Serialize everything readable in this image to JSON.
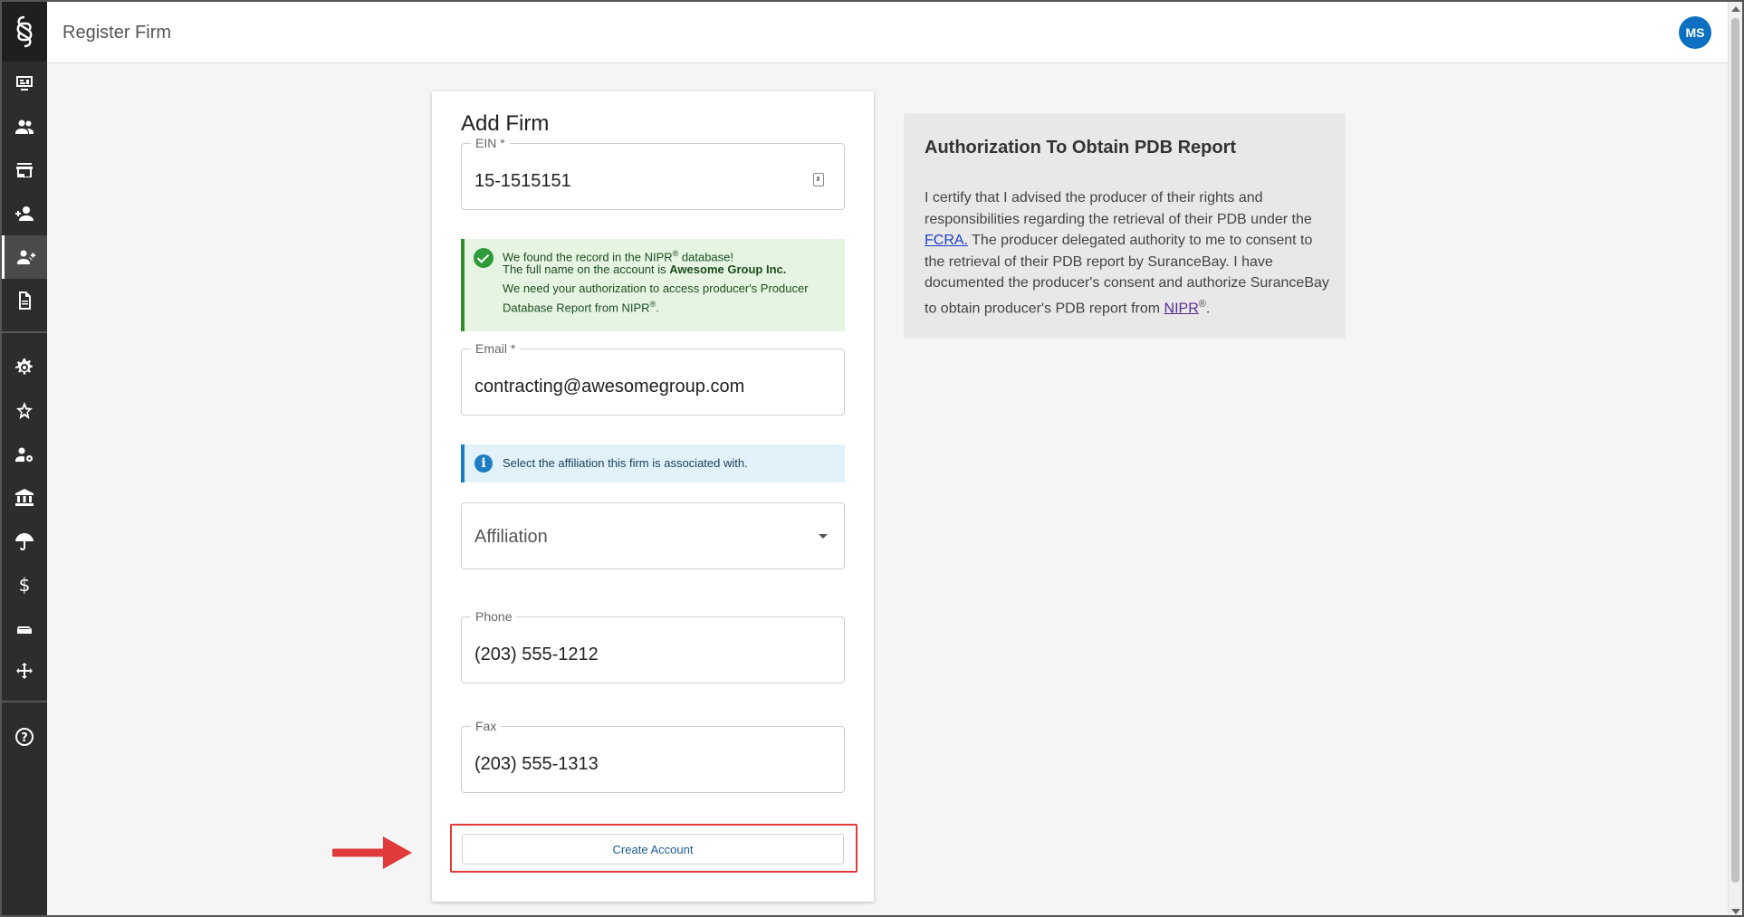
{
  "header": {
    "title": "Register Firm",
    "avatar_initials": "MS"
  },
  "sidebar": {
    "items": [
      {
        "icon": "dashboard-icon"
      },
      {
        "icon": "people-icon"
      },
      {
        "icon": "store-icon"
      },
      {
        "icon": "add-person-icon"
      },
      {
        "icon": "add-group-icon",
        "active": true
      },
      {
        "icon": "document-icon"
      },
      {
        "icon": "gear-icon"
      },
      {
        "icon": "star-badge-icon"
      },
      {
        "icon": "user-settings-icon"
      },
      {
        "icon": "bank-icon"
      },
      {
        "icon": "umbrella-icon"
      },
      {
        "icon": "dollar-icon"
      },
      {
        "icon": "printer-icon"
      },
      {
        "icon": "move-arrows-icon"
      },
      {
        "icon": "help-icon"
      }
    ]
  },
  "form": {
    "title": "Add Firm",
    "ein": {
      "label": "EIN *",
      "value": "15-1515151"
    },
    "success_alert": {
      "line1_pre": "We found the record in the NIPR",
      "line1_sup": "®",
      "line1_post": " database!",
      "line2_pre": "The full name on the account is ",
      "line2_bold": "Awesome Group Inc.",
      "line3": "We need your authorization to access producer's Producer",
      "line4_pre": "Database Report from NIPR",
      "line4_sup": "®",
      "line4_post": "."
    },
    "email": {
      "label": "Email *",
      "value": "contracting@awesomegroup.com"
    },
    "info_alert": "Select the affiliation this firm is associated with.",
    "affiliation": {
      "placeholder": "Affiliation"
    },
    "phone": {
      "label": "Phone",
      "value": "(203) 555-1212"
    },
    "fax": {
      "label": "Fax",
      "value": "(203) 555-1313"
    },
    "create_button": "Create Account"
  },
  "auth": {
    "title": "Authorization To Obtain PDB Report",
    "text1": "I certify that I advised the producer of their rights and responsibilities regarding the retrieval of their PDB under the ",
    "link1": "FCRA.",
    "text2": " The producer delegated authority to me to consent to the retrieval of their PDB report by SuranceBay. I have documented the producer's consent and authorize SuranceBay to obtain producer's PDB report from ",
    "link2": "NIPR",
    "sup": "®",
    "text3": "."
  },
  "colors": {
    "accent": "#0d6fc1",
    "sidebar": "#2d2d2d",
    "success": "#2e9a3a",
    "info": "#1d7dc2",
    "highlight": "#e03a3a"
  }
}
